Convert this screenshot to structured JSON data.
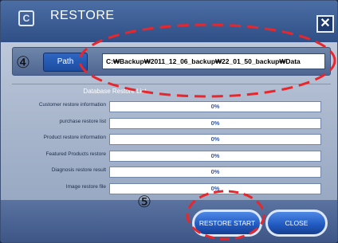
{
  "window": {
    "title": "RESTORE",
    "title_icon": "C",
    "close_glyph": "✕"
  },
  "path": {
    "button_label": "Path",
    "value": "C:₩Backup₩2011_12_06_backup₩22_01_50_backup₩Data"
  },
  "list": {
    "title": "Database Restore List",
    "rows": [
      {
        "label": "Customer restore information",
        "percent_text": "0%",
        "progress": 0
      },
      {
        "label": "purchase restore list",
        "percent_text": "0%",
        "progress": 0
      },
      {
        "label": "Product restore information",
        "percent_text": "0%",
        "progress": 0
      },
      {
        "label": "Featured Products restore",
        "percent_text": "0%",
        "progress": 0
      },
      {
        "label": "Diagnosis restore result",
        "percent_text": "0%",
        "progress": 0
      },
      {
        "label": "Image restore file",
        "percent_text": "0%",
        "progress": 0
      }
    ]
  },
  "buttons": {
    "restore_start": "RESTORE START",
    "close": "CLOSE"
  },
  "annotations": {
    "marker_4": "④",
    "marker_5": "⑤",
    "highlight_color": "#e8262b"
  }
}
